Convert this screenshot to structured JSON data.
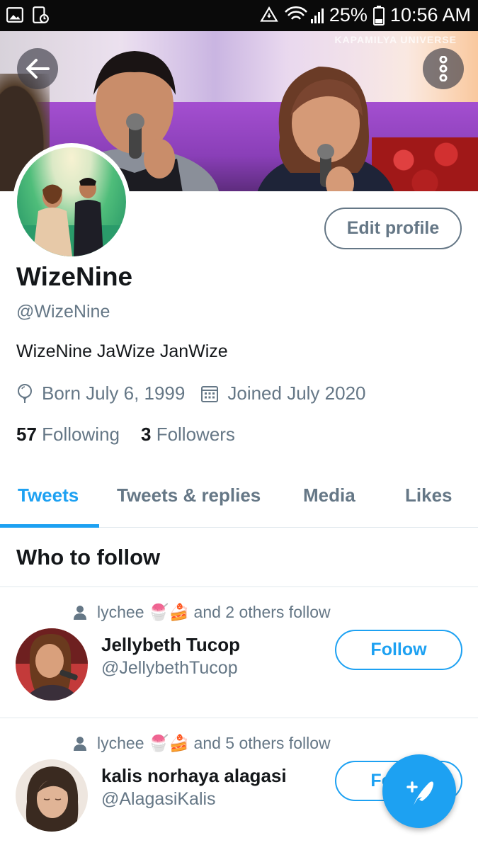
{
  "status_bar": {
    "battery": "25%",
    "time": "10:56 AM"
  },
  "banner": {
    "watermark": "KAPAMILYA UNIVERSE"
  },
  "profile": {
    "edit_label": "Edit profile",
    "name": "WizeNine",
    "handle": "@WizeNine",
    "bio": "WizeNine JaWize JanWize",
    "born": "Born July 6, 1999",
    "joined": "Joined July 2020",
    "following_count": "57",
    "following_label": "Following",
    "followers_count": "3",
    "followers_label": "Followers"
  },
  "tabs": [
    {
      "label": "Tweets",
      "active": true
    },
    {
      "label": "Tweets & replies",
      "active": false
    },
    {
      "label": "Media",
      "active": false
    },
    {
      "label": "Likes",
      "active": false
    }
  ],
  "who_to_follow": {
    "title": "Who to follow",
    "suggestions": [
      {
        "social_context": "lychee 🍧🍰 and 2 others follow",
        "name": "Jellybeth Tucop",
        "handle": "@JellybethTucop",
        "button": "Follow"
      },
      {
        "social_context": "lychee 🍧🍰 and 5 others follow",
        "name": "kalis norhaya alagasi",
        "handle": "@AlagasiKalis",
        "button": "Follow"
      }
    ]
  },
  "colors": {
    "accent": "#1da1f2",
    "secondary_text": "#657786",
    "primary_text": "#14171a"
  }
}
